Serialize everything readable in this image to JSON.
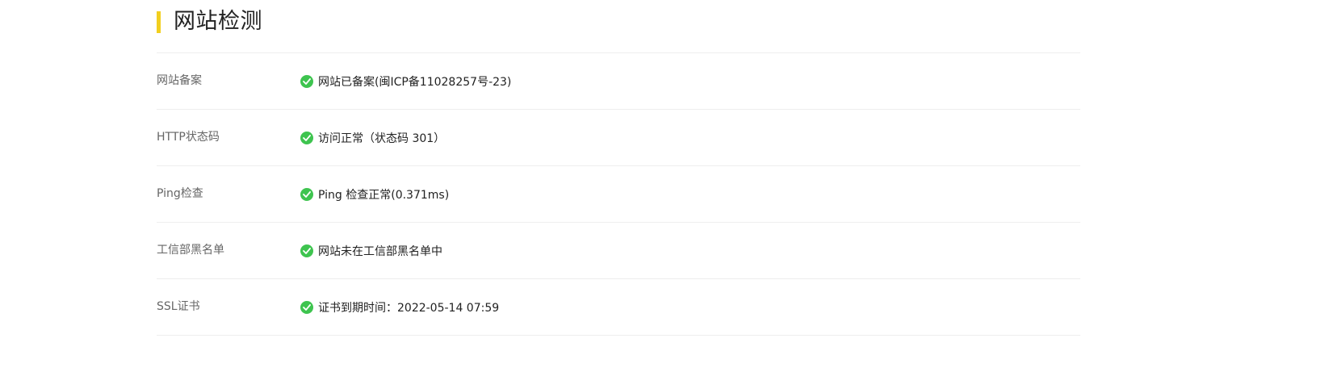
{
  "section": {
    "title": "网站检测",
    "accent_color": "#f2cf1f",
    "status_color": "#3ec44f"
  },
  "rows": [
    {
      "label": "网站备案",
      "status_icon": "check-circle-icon",
      "value": "网站已备案(闽ICP备11028257号-23)"
    },
    {
      "label": "HTTP状态码",
      "status_icon": "check-circle-icon",
      "value": "访问正常（状态码 301）"
    },
    {
      "label": "Ping检查",
      "status_icon": "check-circle-icon",
      "value": "Ping 检查正常(0.371ms)"
    },
    {
      "label": "工信部黑名单",
      "status_icon": "check-circle-icon",
      "value": "网站未在工信部黑名单中"
    },
    {
      "label": "SSL证书",
      "status_icon": "check-circle-icon",
      "value": "证书到期时间：2022-05-14 07:59"
    }
  ]
}
